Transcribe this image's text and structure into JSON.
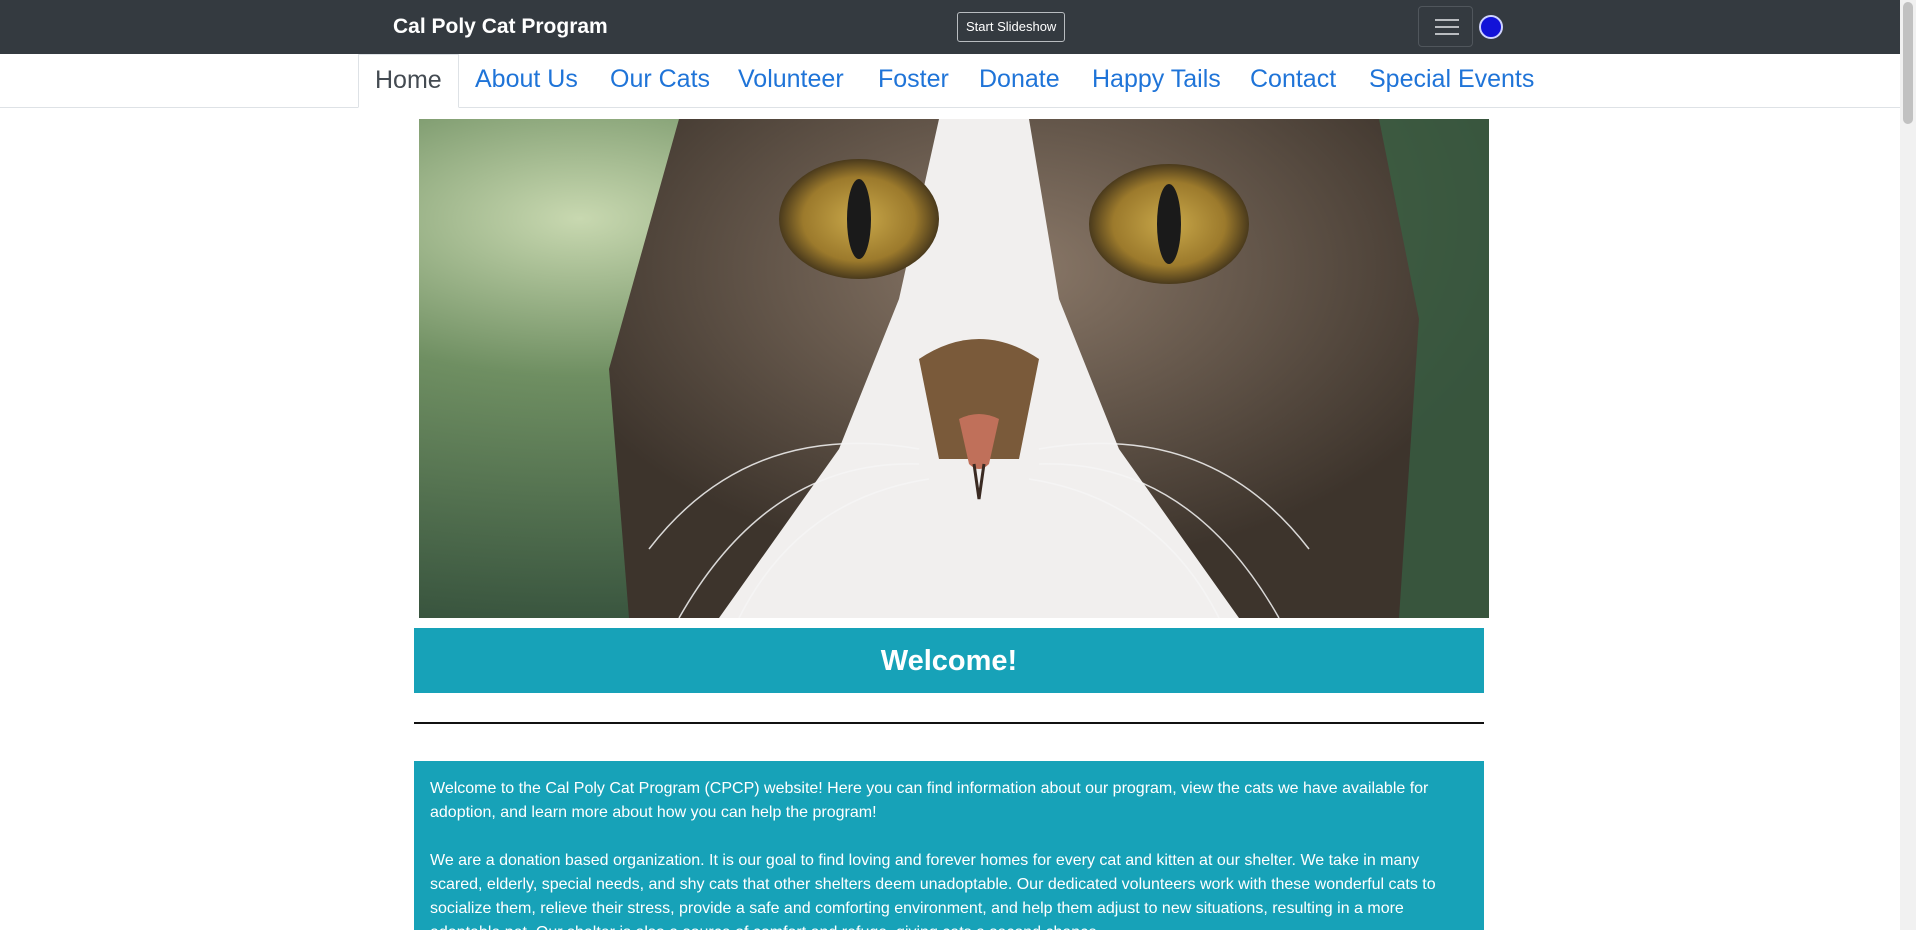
{
  "navbar": {
    "brand": "Cal Poly Cat Program",
    "slideshow_button": "Start Slideshow",
    "menu_icon": "hamburger-menu-icon",
    "status_dot_color": "#1212d8",
    "background": "#343a40"
  },
  "tabs": [
    {
      "label": "Home",
      "active": true
    },
    {
      "label": "About Us"
    },
    {
      "label": "Our Cats"
    },
    {
      "label": "Volunteer"
    },
    {
      "label": "Foster"
    },
    {
      "label": "Donate"
    },
    {
      "label": "Happy Tails"
    },
    {
      "label": "Contact"
    },
    {
      "label": "Special Events"
    }
  ],
  "hero": {
    "subject": "close-up photo of a tabby-and-white cat"
  },
  "welcome": {
    "title": "Welcome!",
    "accent": "#17a2b8"
  },
  "intro": {
    "paragraph1": "Welcome to the Cal Poly Cat Program (CPCP) website! Here you can find information about our program, view the cats we have available for adoption, and learn more about how you can help the program!",
    "paragraph2": "We are a donation based organization. It is our goal to find loving and forever homes for every cat and kitten at our shelter. We take in many scared, elderly, special needs, and shy cats that other shelters deem unadoptable. Our dedicated volunteers work with these wonderful cats to socialize them, relieve their stress, provide a safe and comforting environment, and help them adjust to new situations, resulting in a more adoptable pet. Our shelter is also a source of comfort and refuge, giving cats a second chance."
  }
}
